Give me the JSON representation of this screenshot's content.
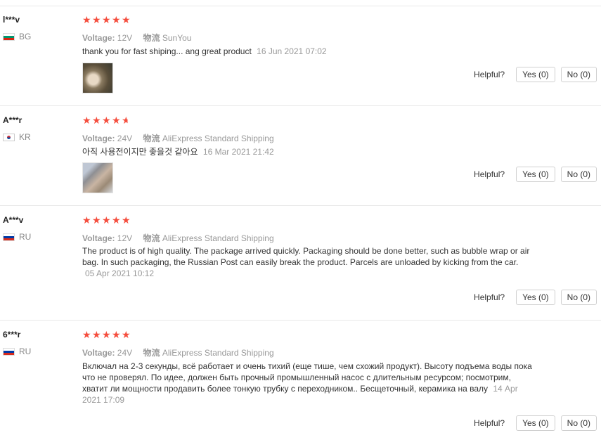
{
  "helpful_label": "Helpful?",
  "meta_labels": {
    "voltage": "Voltage:",
    "shipping": "物流"
  },
  "reviews": [
    {
      "user": "l***v",
      "country": "BG",
      "stars": 5,
      "voltage": "12V",
      "shipping": "SunYou",
      "text": "thank you for fast shiping... ang great product",
      "date": "16 Jun 2021 07:02",
      "yes": "Yes (0)",
      "no": "No (0)"
    },
    {
      "user": "A***r",
      "country": "KR",
      "stars": 4.5,
      "voltage": "24V",
      "shipping": "AliExpress Standard Shipping",
      "text": "아직 사용전이지만 좋을것 같아요",
      "date": "16 Mar 2021 21:42",
      "yes": "Yes (0)",
      "no": "No (0)"
    },
    {
      "user": "A***v",
      "country": "RU",
      "stars": 5,
      "voltage": "12V",
      "shipping": "AliExpress Standard Shipping",
      "text": "The product is of high quality. The package arrived quickly. Packaging should be done better, such as bubble wrap or air bag. In such packaging, the Russian Post can easily break the product. Parcels are unloaded by kicking from the car.",
      "date": "05 Apr 2021 10:12",
      "yes": "Yes (0)",
      "no": "No (0)"
    },
    {
      "user": "6***r",
      "country": "RU",
      "stars": 5,
      "voltage": "24V",
      "shipping": "AliExpress Standard Shipping",
      "text": "Включал на 2-3 секунды, всё работает и очень тихий (еще тише, чем схожий продукт). Высоту подъема воды пока что не проверял. По идее, должен быть прочный промышленный насос с длительным ресурсом; посмотрим, хватит ли мощности продавить более тонкую трубку с переходником.. Бесщеточный, керамика на валу",
      "date": "14 Apr 2021 17:09",
      "yes": "Yes (0)",
      "no": "No (0)"
    }
  ]
}
